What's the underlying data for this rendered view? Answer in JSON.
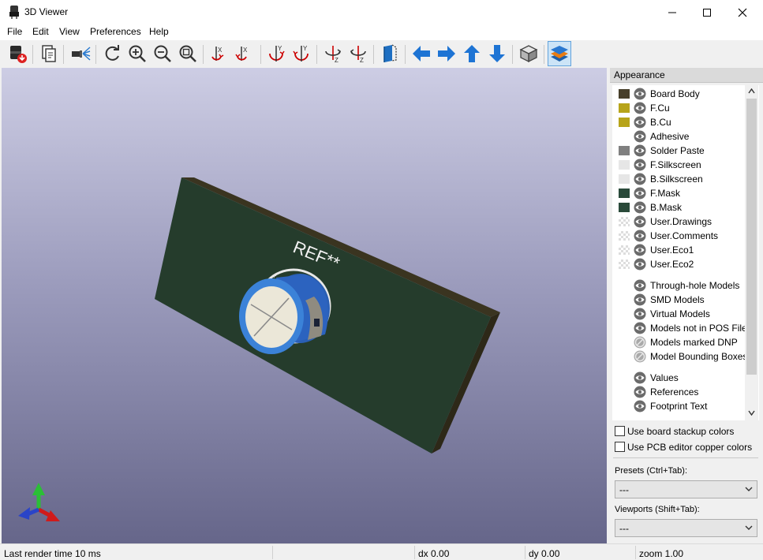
{
  "window": {
    "title": "3D Viewer",
    "controls": [
      "minimize-icon",
      "maximize-icon",
      "close-icon"
    ]
  },
  "menu": [
    "File",
    "Edit",
    "View",
    "Preferences",
    "Help"
  ],
  "toolbar": [
    {
      "name": "render-raytracing-button",
      "icon": "raytrace-icon"
    },
    {
      "name": "copy-3d-image-button",
      "icon": "copy-icon"
    },
    {
      "name": "display-options-button",
      "icon": "flashlight-icon"
    },
    {
      "name": "reload-board-button",
      "icon": "refresh-icon"
    },
    {
      "name": "zoom-in-button",
      "icon": "zoom-in-icon"
    },
    {
      "name": "zoom-out-button",
      "icon": "zoom-out-icon"
    },
    {
      "name": "zoom-fit-button",
      "icon": "zoom-fit-icon"
    },
    {
      "name": "rotate-x-cw-button",
      "icon": "rotate-x-cw-icon"
    },
    {
      "name": "rotate-x-ccw-button",
      "icon": "rotate-x-ccw-icon"
    },
    {
      "name": "rotate-y-cw-button",
      "icon": "rotate-y-cw-icon"
    },
    {
      "name": "rotate-y-ccw-button",
      "icon": "rotate-y-ccw-icon"
    },
    {
      "name": "rotate-z-cw-button",
      "icon": "rotate-z-cw-icon"
    },
    {
      "name": "rotate-z-ccw-button",
      "icon": "rotate-z-ccw-icon"
    },
    {
      "name": "flip-board-button",
      "icon": "flip-board-icon"
    },
    {
      "name": "move-left-button",
      "icon": "arrow-left-icon"
    },
    {
      "name": "move-right-button",
      "icon": "arrow-right-icon"
    },
    {
      "name": "move-up-button",
      "icon": "arrow-up-icon"
    },
    {
      "name": "move-down-button",
      "icon": "arrow-down-icon"
    },
    {
      "name": "toggle-orthographic-button",
      "icon": "cube-icon"
    },
    {
      "name": "toggle-appearance-panel-button",
      "icon": "layers-icon",
      "active": true
    }
  ],
  "viewport": {
    "reference_text": "REF**",
    "board_color": "#253c2c",
    "background_top": "#cdcde4",
    "background_bottom": "#66668a"
  },
  "appearance": {
    "title": "Appearance",
    "layers": [
      {
        "label": "Board Body",
        "color": "#473f2a",
        "eye": "visible"
      },
      {
        "label": "F.Cu",
        "color": "#b7a41a",
        "eye": "visible"
      },
      {
        "label": "B.Cu",
        "color": "#b7a41a",
        "eye": "visible"
      },
      {
        "label": "Adhesive",
        "color": "none",
        "eye": "visible"
      },
      {
        "label": "Solder Paste",
        "color": "#808080",
        "eye": "visible"
      },
      {
        "label": "F.Silkscreen",
        "color": "#e6e6e6",
        "eye": "visible"
      },
      {
        "label": "B.Silkscreen",
        "color": "#e6e6e6",
        "eye": "visible"
      },
      {
        "label": "F.Mask",
        "color": "#2a4a3a",
        "eye": "visible"
      },
      {
        "label": "B.Mask",
        "color": "#2a4a3a",
        "eye": "visible"
      },
      {
        "label": "User.Drawings",
        "color": "checker",
        "eye": "visible"
      },
      {
        "label": "User.Comments",
        "color": "checker",
        "eye": "visible"
      },
      {
        "label": "User.Eco1",
        "color": "checker",
        "eye": "visible"
      },
      {
        "label": "User.Eco2",
        "color": "checker",
        "eye": "visible"
      },
      {
        "label": "Through-hole Models",
        "color": "none",
        "eye": "visible"
      },
      {
        "label": "SMD Models",
        "color": "none",
        "eye": "visible"
      },
      {
        "label": "Virtual Models",
        "color": "none",
        "eye": "visible"
      },
      {
        "label": "Models not in POS File",
        "color": "none",
        "eye": "visible"
      },
      {
        "label": "Models marked DNP",
        "color": "none",
        "eye": "hidden"
      },
      {
        "label": "Model Bounding Boxes",
        "color": "none",
        "eye": "hidden"
      },
      {
        "label": "Values",
        "color": "none",
        "eye": "visible"
      },
      {
        "label": "References",
        "color": "none",
        "eye": "visible"
      },
      {
        "label": "Footprint Text",
        "color": "none",
        "eye": "visible"
      }
    ],
    "use_board_stackup_colors": {
      "label": "Use board stackup colors",
      "checked": false
    },
    "use_pcb_editor_copper_colors": {
      "label": "Use PCB editor copper colors",
      "checked": false
    },
    "presets_label": "Presets (Ctrl+Tab):",
    "presets_value": "---",
    "viewports_label": "Viewports (Shift+Tab):",
    "viewports_value": "---"
  },
  "status": {
    "render_time": "Last render time 10 ms",
    "dx": "dx 0.00",
    "dy": "dy 0.00",
    "zoom": "zoom 1.00"
  }
}
